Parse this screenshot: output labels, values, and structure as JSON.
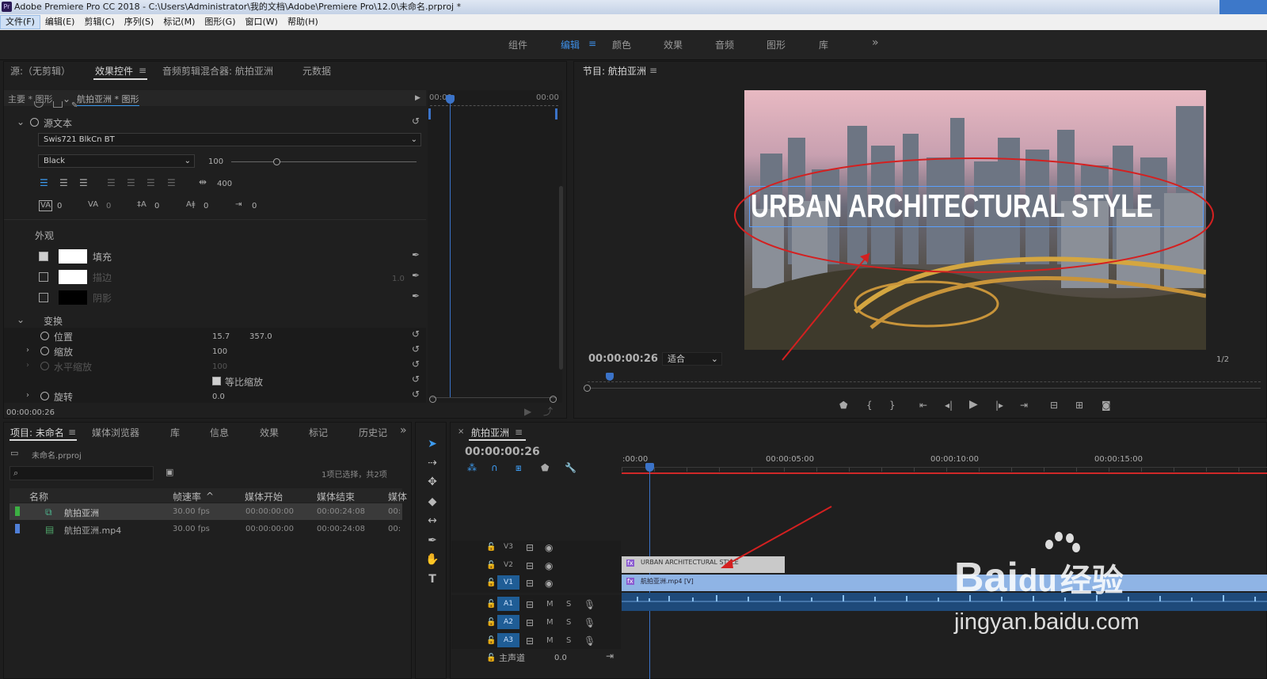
{
  "window": {
    "title": "Adobe Premiere Pro CC 2018 - C:\\Users\\Administrator\\我的文档\\Adobe\\Premiere Pro\\12.0\\未命名.prproj *",
    "logo": "Pr"
  },
  "menu": [
    "文件(F)",
    "编辑(E)",
    "剪辑(C)",
    "序列(S)",
    "标记(M)",
    "图形(G)",
    "窗口(W)",
    "帮助(H)"
  ],
  "workspaces": {
    "tabs": [
      "组件",
      "编辑",
      "颜色",
      "效果",
      "音频",
      "图形",
      "库"
    ],
    "active_menu_icon": "≡",
    "more": "»"
  },
  "source_panel": {
    "tabs": [
      "源:（无剪辑）",
      "效果控件",
      "音频剪辑混合器: 航拍亚洲",
      "元数据"
    ],
    "menu_icon": "≡",
    "master": "主要 * 图形",
    "clip": "航拍亚洲 * 图形",
    "tl_start": "00:00",
    "tl_end": "00:00",
    "source_text_label": "源文本",
    "font": "Swis721 BlkCn BT",
    "style": "Black",
    "size": "100",
    "tracking": "400",
    "kern_values": [
      "0",
      "0",
      "0",
      "0",
      "0"
    ],
    "appearance_label": "外观",
    "fill_label": "填充",
    "stroke_label": "描边",
    "stroke_width": "1.0",
    "shadow_label": "阴影",
    "transform_label": "变换",
    "position_label": "位置",
    "pos_x": "15.7",
    "pos_y": "357.0",
    "scale_label": "缩放",
    "scale": "100",
    "hscale_label": "水平缩放",
    "hscale": "100",
    "uniform_label": "等比缩放",
    "rotation_label": "旋转",
    "rotation": "0.0",
    "timecode": "00:00:00:26",
    "colors": {
      "fill": "#ffffff",
      "stroke": "#ffffff",
      "shadow": "#000000"
    }
  },
  "program_monitor": {
    "title": "节目: 航拍亚洲",
    "menu_icon": "≡",
    "overlay_text": "URBAN ARCHITECTURAL STYLE",
    "timecode": "00:00:00:26",
    "fit": "适合",
    "resolution": "1/2"
  },
  "project_panel": {
    "tabs": [
      "项目: 未命名",
      "媒体浏览器",
      "库",
      "信息",
      "效果",
      "标记",
      "历史记"
    ],
    "more": "»",
    "menu_icon": "≡",
    "project_file": "未命名.prproj",
    "search_placeholder": "",
    "selection_info": "1项已选择，共2项",
    "columns": [
      "名称",
      "帧速率",
      "媒体开始",
      "媒体结束",
      "媒体"
    ],
    "sort_icon": "^",
    "rows": [
      {
        "name": "航拍亚洲",
        "fps": "30.00 fps",
        "start": "00:00:00:00",
        "end": "00:00:24:08",
        "dur": "00:",
        "color": "#3cb043"
      },
      {
        "name": "航拍亚洲.mp4",
        "fps": "30.00 fps",
        "start": "00:00:00:00",
        "end": "00:00:24:08",
        "dur": "00:",
        "color": "#4f7fd8"
      }
    ]
  },
  "timeline": {
    "close": "×",
    "title": "航拍亚洲",
    "menu_icon": "≡",
    "timecode": "00:00:00:26",
    "ruler": [
      ":00:00",
      "00:00:05:00",
      "00:00:10:00",
      "00:00:15:00"
    ],
    "tracks_video": [
      "V3",
      "V2",
      "V1"
    ],
    "tracks_audio": [
      "A1",
      "A2",
      "A3"
    ],
    "master_label": "主声道",
    "master_value": "0.0",
    "m": "M",
    "s": "S",
    "clip_title": "URBAN ARCHITECTURAL STYLE",
    "clip_video": "航拍亚洲.mp4 [V]",
    "fx_icon": "fx"
  },
  "watermark": {
    "brand": "Bai",
    "du": "du",
    "jingyan": "经验",
    "url": "jingyan.baidu.com"
  }
}
